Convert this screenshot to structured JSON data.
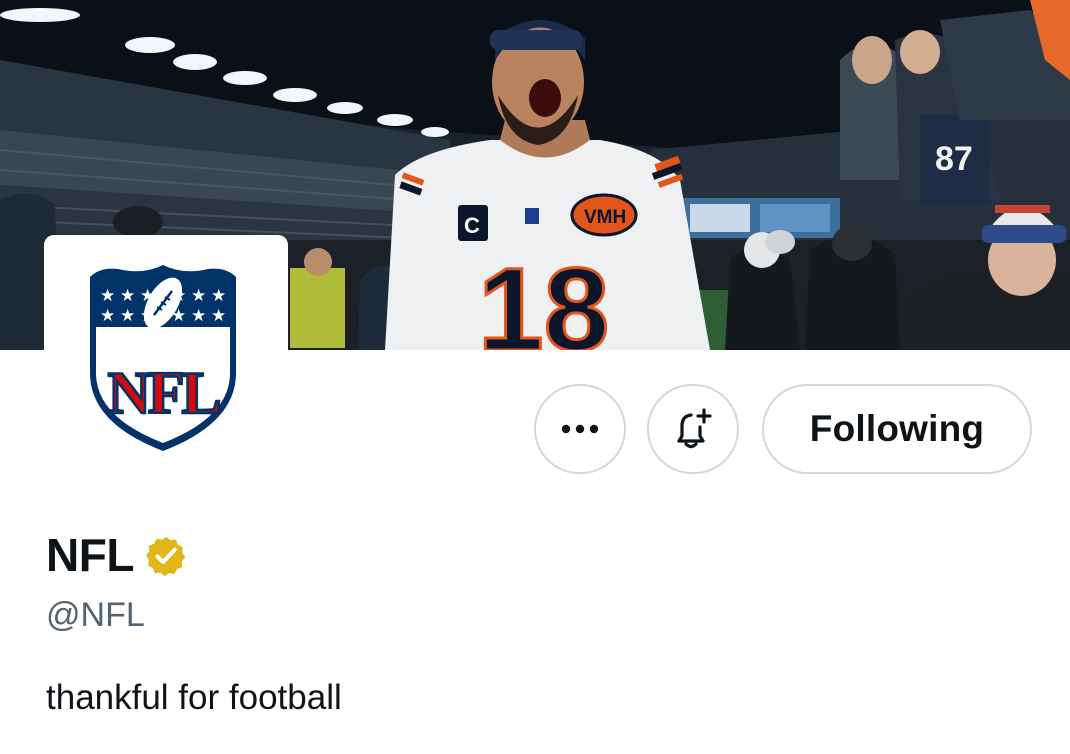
{
  "banner": {
    "image": "stadium-celebration-photo",
    "jersey_number": "18",
    "jersey_patch": "VMH",
    "captain_patch": "C",
    "fan_jersey_number": "87"
  },
  "avatar": {
    "image": "nfl-shield-logo",
    "logo_text": "NFL"
  },
  "actions": {
    "more_label": "•••",
    "bell_icon": "bell-plus-icon",
    "follow_label": "Following"
  },
  "profile": {
    "display_name": "NFL",
    "verified_icon": "gold-verified-badge-icon",
    "handle": "@NFL",
    "bio": "thankful for football"
  },
  "colors": {
    "verified_gold": "#e2b719",
    "nfl_blue": "#013369",
    "nfl_red": "#d50a0a",
    "border": "#cfd9de",
    "secondary_text": "#536471"
  }
}
